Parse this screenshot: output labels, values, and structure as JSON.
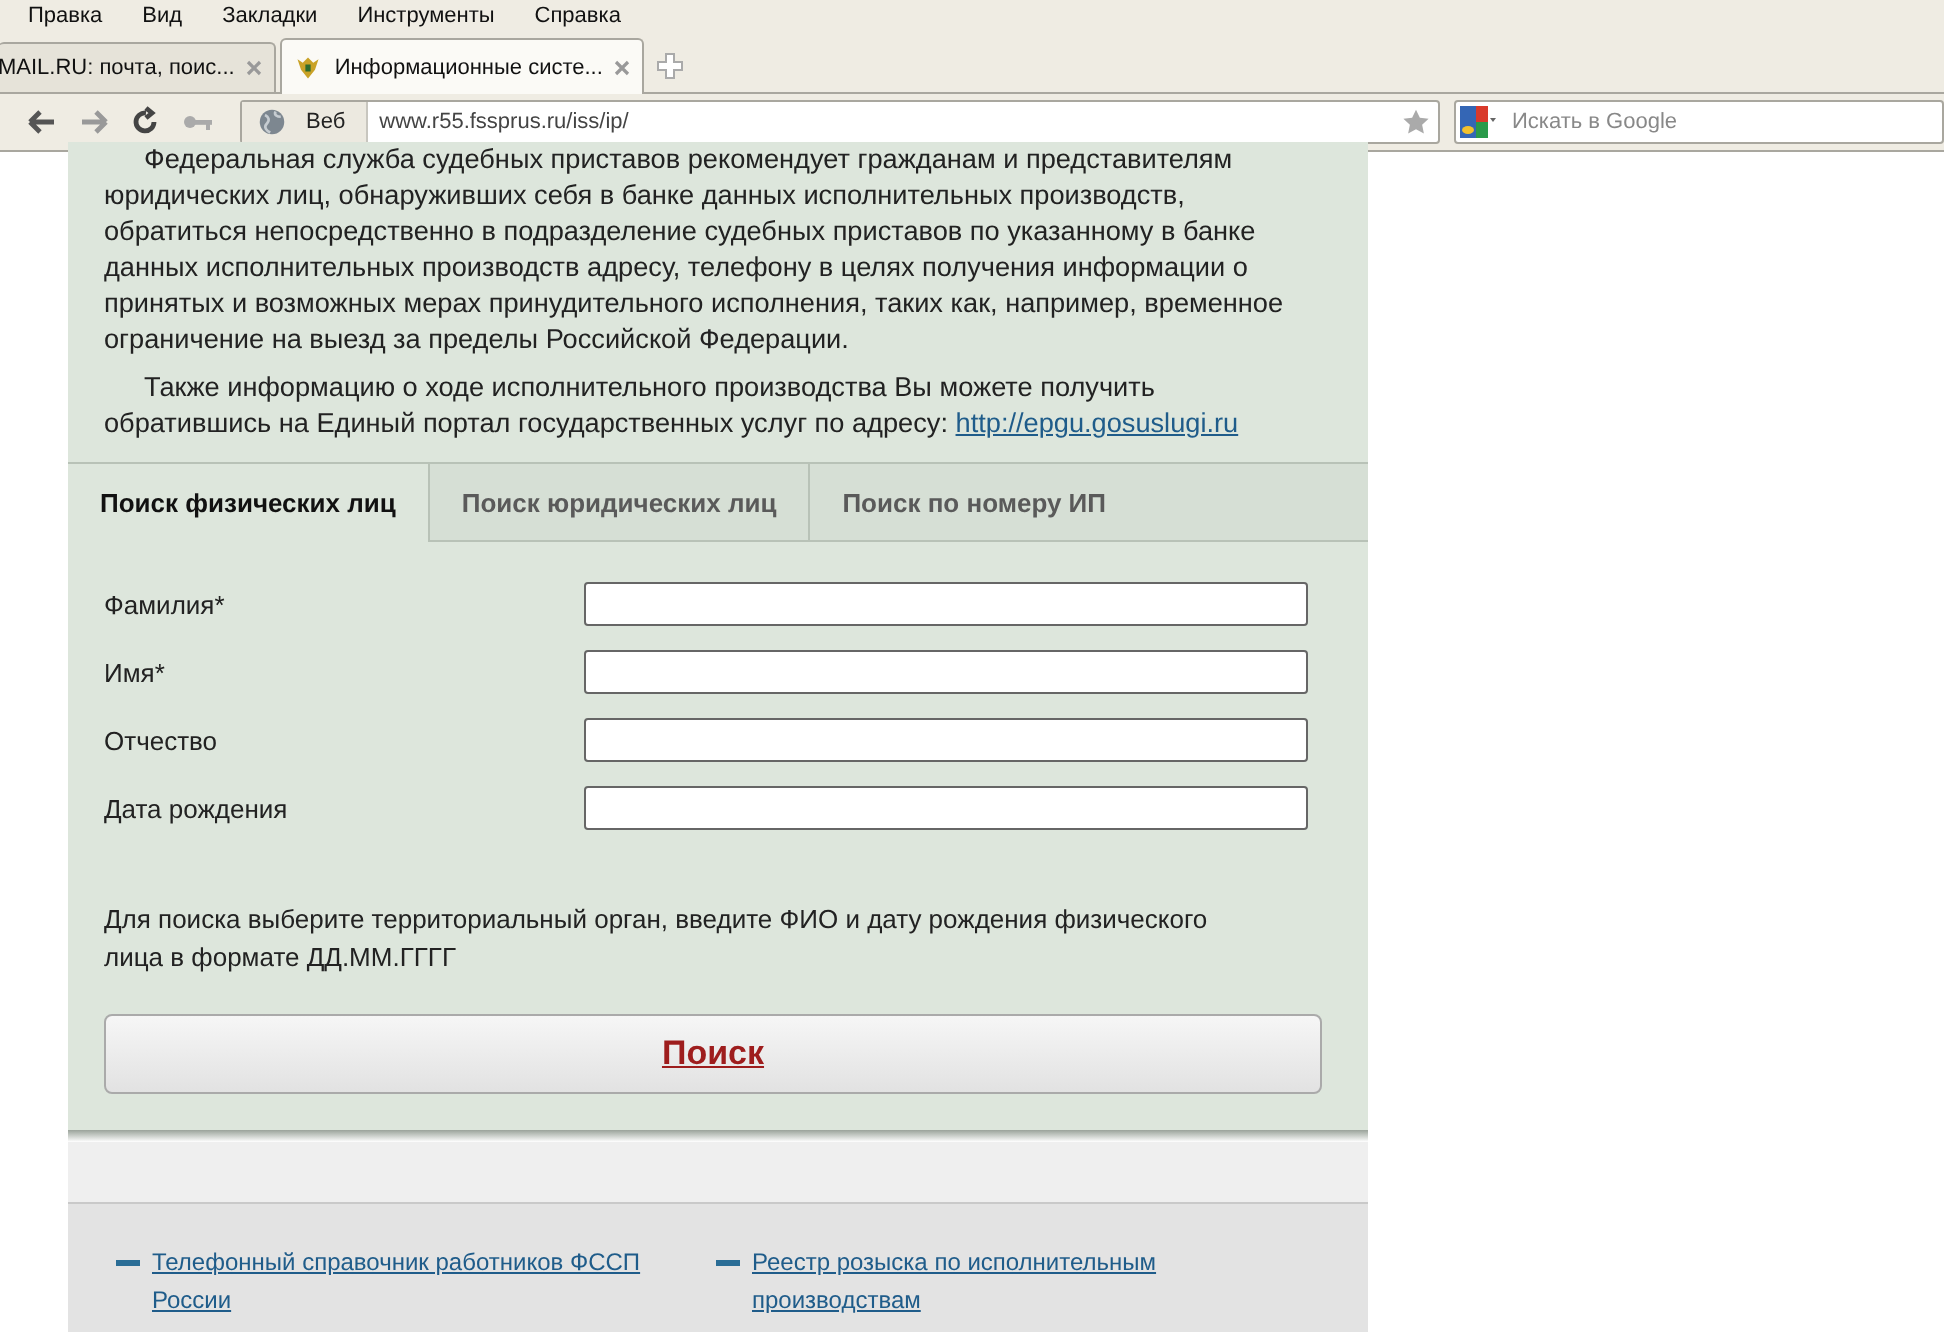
{
  "menu": [
    "Правка",
    "Вид",
    "Закладки",
    "Инструменты",
    "Справка"
  ],
  "browser_tabs": [
    {
      "title": "MAIL.RU: почта, поис...",
      "selected": false
    },
    {
      "title": "Информационные систе...",
      "selected": true
    }
  ],
  "nav": {
    "web_button": "Веб",
    "url": "www.r55.fssprus.ru/iss/ip/",
    "search_placeholder": "Искать в Google"
  },
  "intro": [
    "Федеральная служба судебных приставов рекомендует гражданам и представителям юридических лиц, обнаруживших себя в банке данных исполнительных производств, обратиться непосредственно в подразделение судебных приставов по указанному в банке данных исполнительных производств адресу, телефону в целях получения информации о принятых и возможных мерах принудительного исполнения, таких как, например, временное ограничение на выезд за пределы Российской Федерации."
  ],
  "intro_2": {
    "text": "Также информацию о ходе исполнительного производства Вы можете получить обратившись на Единый портал государственных услуг по адресу:",
    "link": "http://epgu.gosuslugi.ru"
  },
  "search_tabs": [
    {
      "label": "Поиск физических лиц",
      "selected": true
    },
    {
      "label": "Поиск юридических лиц",
      "selected": false
    },
    {
      "label": "Поиск по номеру ИП",
      "selected": false
    }
  ],
  "fields": [
    {
      "label": "Фамилия*"
    },
    {
      "label": "Имя*"
    },
    {
      "label": "Отчество"
    },
    {
      "label": "Дата рождения"
    }
  ],
  "hint": "Для поиска выберите территориальный орган, введите ФИО и дату рождения физического лица в формате ДД.ММ.ГГГГ",
  "search_button": "Поиск",
  "footer_links": [
    "Телефонный справочник работников ФССП России",
    "Реестр розыска по исполнительным производствам"
  ]
}
